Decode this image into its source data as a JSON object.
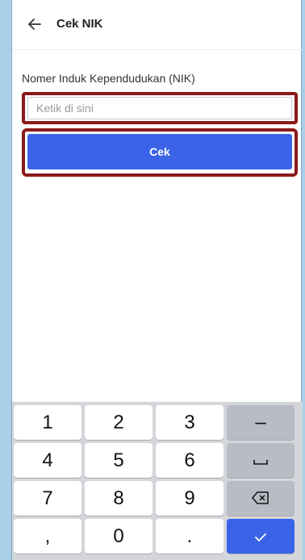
{
  "header": {
    "title": "Cek NIK"
  },
  "form": {
    "label": "Nomer Induk Kependudukan (NIK)",
    "placeholder": "Ketik di sini",
    "value": "",
    "button_label": "Cek"
  },
  "keypad": {
    "rows": [
      [
        "1",
        "2",
        "3"
      ],
      [
        "4",
        "5",
        "6"
      ],
      [
        "7",
        "8",
        "9"
      ],
      [
        ",",
        "0",
        "."
      ]
    ],
    "func_keys": [
      "–",
      "space-icon",
      "backspace-icon",
      "check-icon"
    ],
    "func_key_color": "#b8bcc4",
    "done_key_color": "#3a63e8"
  },
  "colors": {
    "accent": "#3a63e8",
    "highlight_border": "#8b1a1a"
  }
}
